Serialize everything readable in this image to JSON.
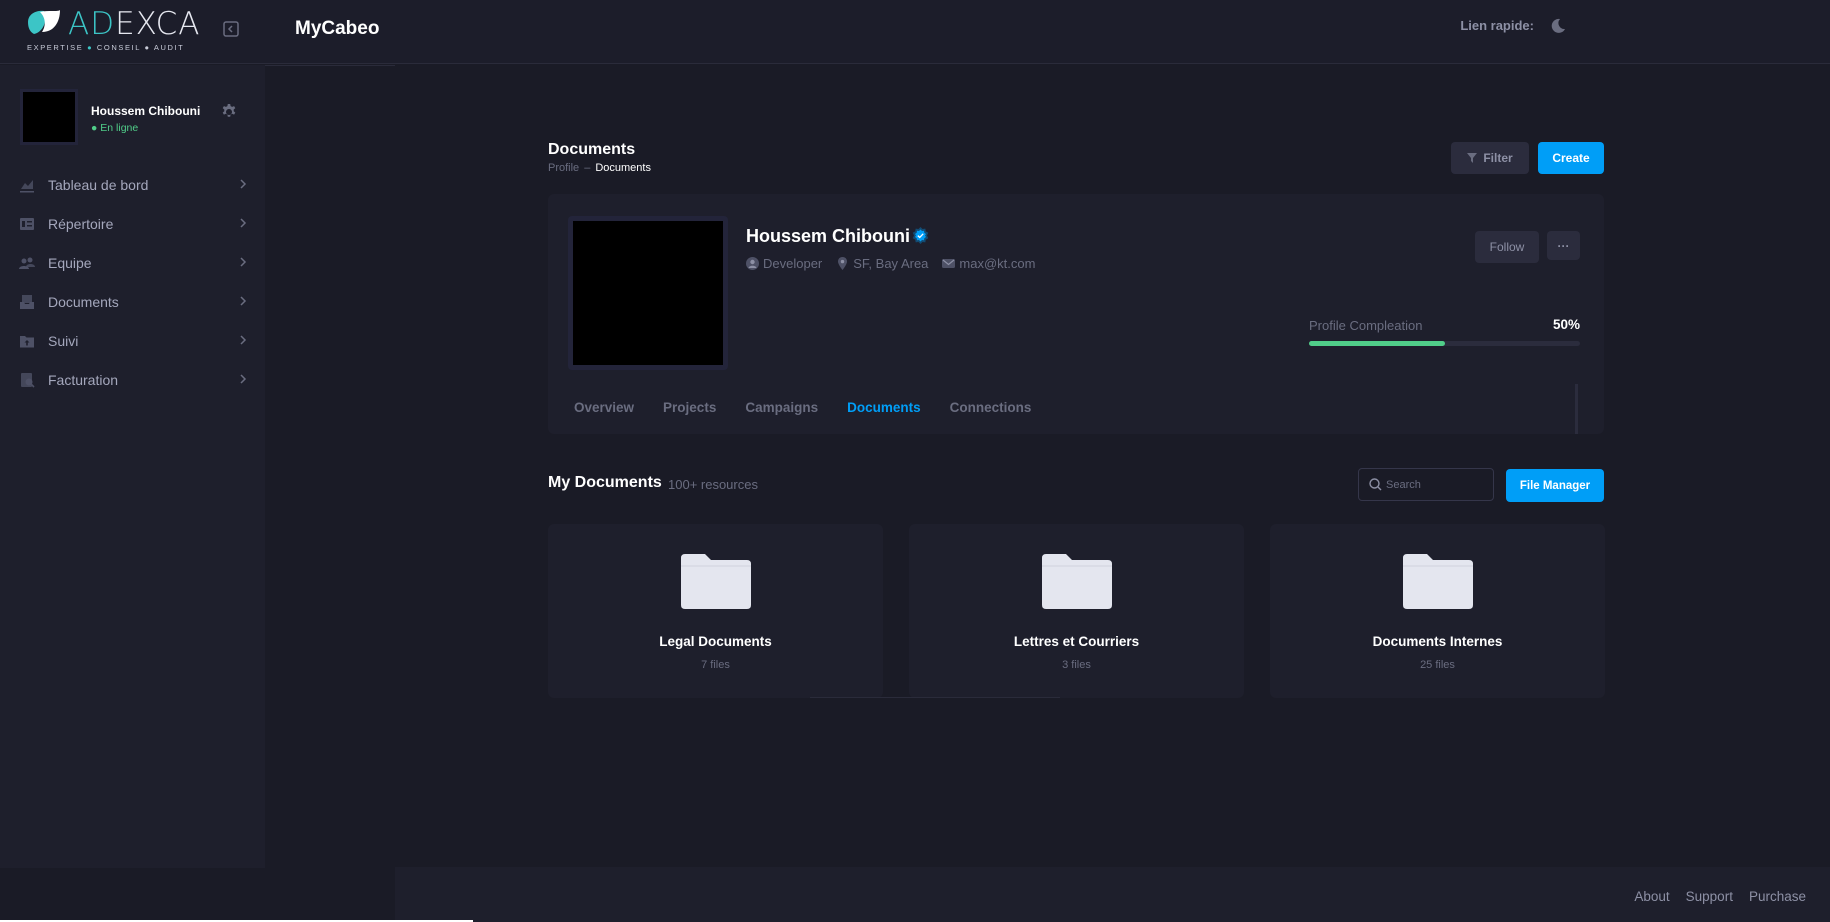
{
  "header": {
    "logo_text_a": "AD",
    "logo_text_b": "EXCA",
    "logo_tagline_1": "EXPERTISE",
    "logo_tagline_2": "CONSEIL",
    "logo_tagline_3": "AUDIT",
    "app_title": "MyCabeo",
    "quick_link_label": "Lien rapide:"
  },
  "sidebar": {
    "user": {
      "name": "Houssem Chibouni",
      "status": "En ligne"
    },
    "items": [
      {
        "label": "Tableau de bord",
        "icon": "chart-icon"
      },
      {
        "label": "Répertoire",
        "icon": "directory-icon"
      },
      {
        "label": "Equipe",
        "icon": "team-icon"
      },
      {
        "label": "Documents",
        "icon": "documents-icon"
      },
      {
        "label": "Suivi",
        "icon": "folder-upload-icon"
      },
      {
        "label": "Facturation",
        "icon": "billing-icon"
      }
    ]
  },
  "toolbar": {
    "title": "Documents",
    "breadcrumb": [
      "Profile",
      "Documents"
    ],
    "filter_label": "Filter",
    "create_label": "Create"
  },
  "profile": {
    "name": "Houssem Chibouni",
    "role": "Developer",
    "location": "SF, Bay Area",
    "email": "max@kt.com",
    "follow_label": "Follow",
    "more_label": "···",
    "completion_label": "Profile Compleation",
    "completion_value": "50%",
    "completion_fraction": 0.5,
    "tabs": [
      "Overview",
      "Projects",
      "Campaigns",
      "Documents",
      "Connections"
    ],
    "active_tab": "Documents"
  },
  "documents": {
    "title": "My Documents",
    "count": "100+ resources",
    "search_placeholder": "Search",
    "file_manager_label": "File Manager",
    "folders": [
      {
        "name": "Legal Documents",
        "files": "7 files"
      },
      {
        "name": "Lettres et Courriers",
        "files": "3 files"
      },
      {
        "name": "Documents Internes",
        "files": "25 files"
      }
    ]
  },
  "footer": {
    "links": [
      "About",
      "Support",
      "Purchase"
    ]
  },
  "colors": {
    "primary": "#009ef7",
    "success": "#50cd89",
    "background": "#1a1b26",
    "card": "#1e1f2c",
    "logo_accent": "#3cc5c6"
  }
}
